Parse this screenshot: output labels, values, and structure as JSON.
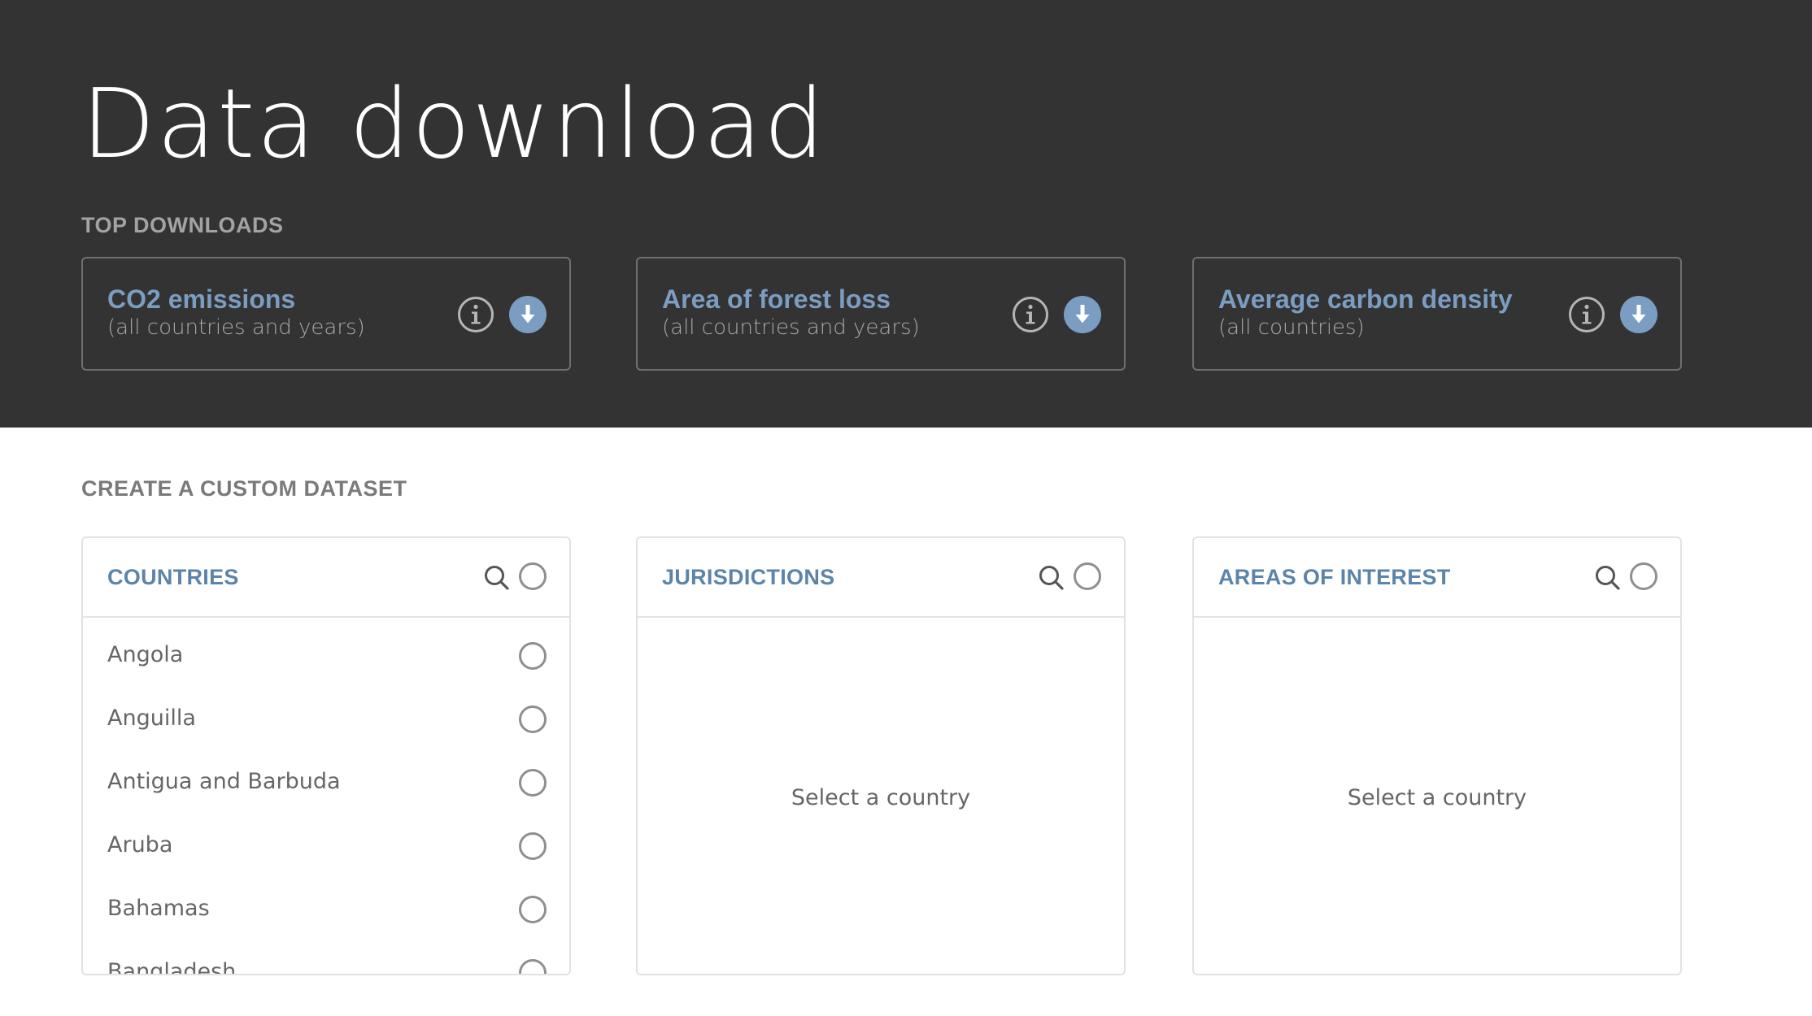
{
  "header": {
    "title": "Data download"
  },
  "top_downloads": {
    "label": "TOP DOWNLOADS",
    "cards": [
      {
        "title": "CO2 emissions",
        "subtitle": "(all countries and years)"
      },
      {
        "title": "Area of forest loss",
        "subtitle": "(all countries and years)"
      },
      {
        "title": "Average carbon density",
        "subtitle": "(all countries)"
      }
    ]
  },
  "custom_dataset": {
    "label": "CREATE A CUSTOM DATASET",
    "panels": {
      "countries": {
        "title": "COUNTRIES",
        "items": [
          "Angola",
          "Anguilla",
          "Antigua and Barbuda",
          "Aruba",
          "Bahamas",
          "Bangladesh"
        ]
      },
      "jurisdictions": {
        "title": "JURISDICTIONS",
        "placeholder": "Select a country"
      },
      "areas_of_interest": {
        "title": "AREAS OF INTEREST",
        "placeholder": "Select a country"
      }
    }
  },
  "colors": {
    "hero_background": "#333333",
    "accent_blue": "#7a9dc1",
    "panel_title_blue": "#5c84ab",
    "download_button": "#7a9dc1"
  },
  "icons": {
    "info": "info-icon",
    "download": "download-icon",
    "search": "search-icon",
    "select": "radio-icon"
  }
}
